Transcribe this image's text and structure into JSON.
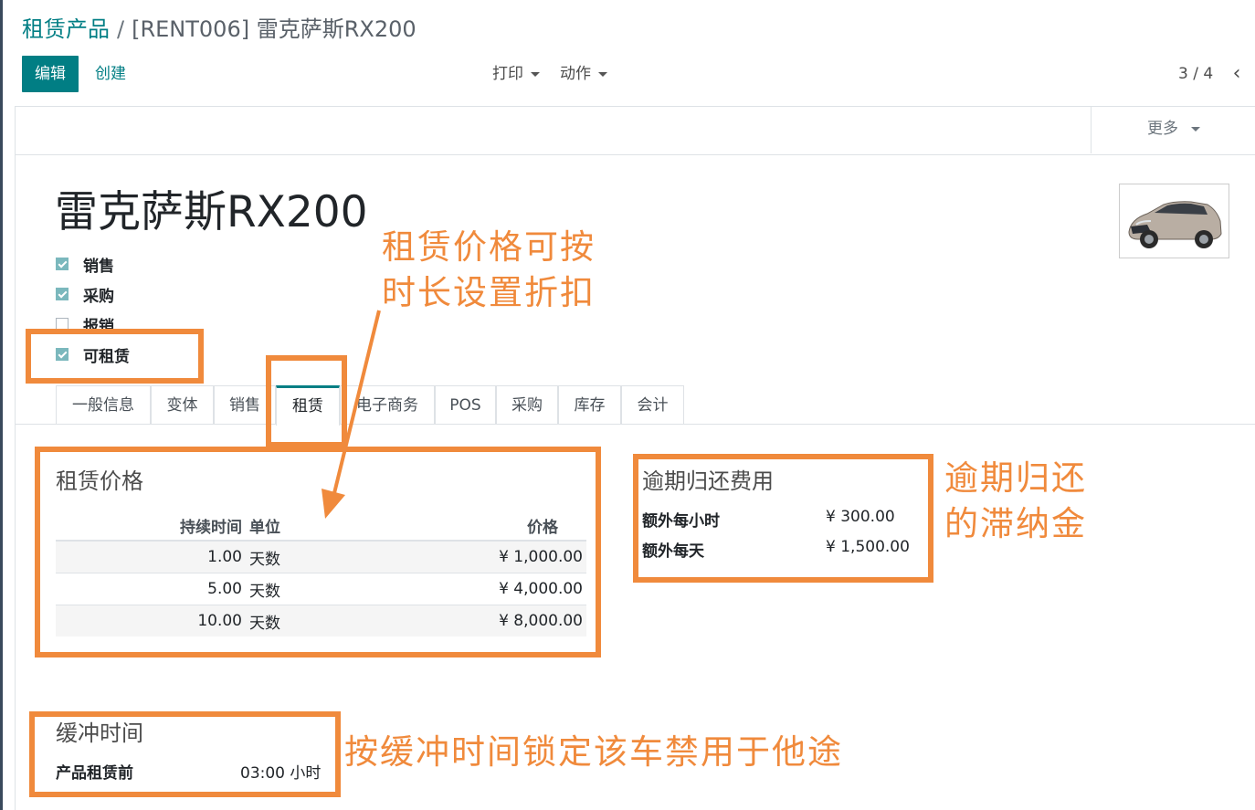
{
  "breadcrumb": {
    "parent": "租赁产品",
    "separator": "/",
    "current": "[RENT006] 雷克萨斯RX200"
  },
  "buttons": {
    "edit": "编辑",
    "create": "创建"
  },
  "dropdowns": {
    "print": "打印",
    "action": "动作"
  },
  "pager": {
    "value": "3 / 4"
  },
  "status_bar": {
    "more": "更多"
  },
  "product": {
    "name": "雷克萨斯RX200",
    "image": "lexus-suv-image",
    "options": [
      {
        "label": "销售",
        "checked": true
      },
      {
        "label": "采购",
        "checked": true
      },
      {
        "label": "报销",
        "checked": false
      },
      {
        "label": "可租赁",
        "checked": true
      }
    ]
  },
  "tabs": [
    {
      "label": "一般信息"
    },
    {
      "label": "变体"
    },
    {
      "label": "销售"
    },
    {
      "label": "租赁",
      "active": true
    },
    {
      "label": "电子商务"
    },
    {
      "label": "POS"
    },
    {
      "label": "采购"
    },
    {
      "label": "库存"
    },
    {
      "label": "会计"
    }
  ],
  "rental_pricing": {
    "title": "租赁价格",
    "columns": {
      "duration": "持续时间",
      "unit": "单位",
      "price": "价格"
    },
    "rows": [
      {
        "duration": "1.00",
        "unit": "天数",
        "price": "¥ 1,000.00"
      },
      {
        "duration": "5.00",
        "unit": "天数",
        "price": "¥ 4,000.00"
      },
      {
        "duration": "10.00",
        "unit": "天数",
        "price": "¥ 8,000.00"
      }
    ]
  },
  "late_return": {
    "title": "逾期归还费用",
    "extra_hour_label": "额外每小时",
    "extra_hour_value": "¥ 300.00",
    "extra_day_label": "额外每天",
    "extra_day_value": "¥ 1,500.00"
  },
  "buffer": {
    "title": "缓冲时间",
    "before_label": "产品租赁前",
    "before_value": "03:00 小时"
  },
  "annotations": {
    "discount_line1": "租赁价格可按",
    "discount_line2": "时长设置折扣",
    "late_line1": "逾期归还",
    "late_line2": "的滞纳金",
    "buffer": "按缓冲时间锁定该车禁用于他途"
  },
  "colors": {
    "primary": "#017e84",
    "annotation": "#f08a3c"
  }
}
